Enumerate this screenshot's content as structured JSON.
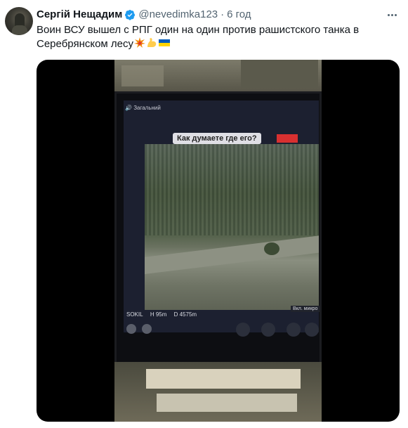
{
  "author": {
    "display_name": "Сергій Нещадим",
    "handle": "@nevedimka123",
    "separator": "·",
    "timestamp": "6 год",
    "verified_icon": "verified-badge-icon"
  },
  "tweet": {
    "text_line1": "Воин ВСУ вышел с РПГ один на один против рашистского танка в",
    "text_line2": "Серебрянском лесу",
    "emojis": [
      "collision-icon",
      "flexed-biceps-icon",
      "ukraine-flag-icon"
    ]
  },
  "video": {
    "channel_label": "Загальний",
    "overlay_caption": "Как думаете где его?",
    "hud_callsign": "SOKIL",
    "hud_height": "H 95m",
    "hud_distance": "D 4575m",
    "tooltip": "Вкл. микро"
  },
  "colors": {
    "name": "#0f1419",
    "secondary": "#536471",
    "verified": "#1d9bf0",
    "media_bg": "#000000"
  }
}
